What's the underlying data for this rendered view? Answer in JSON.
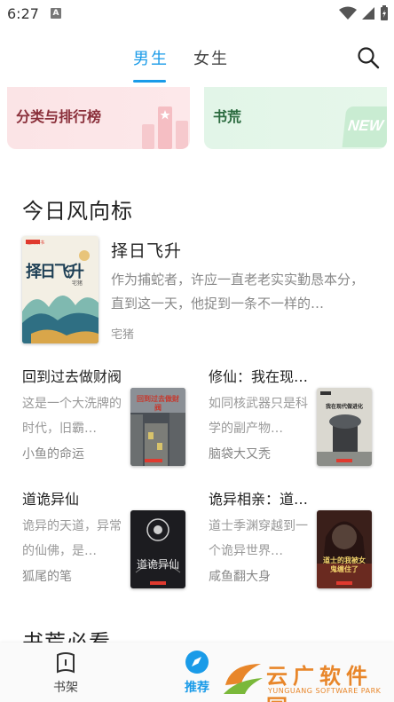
{
  "status_bar": {
    "time": "6:27",
    "notif_letter": "A"
  },
  "tabs": [
    {
      "label": "男生"
    },
    {
      "label": "女生"
    }
  ],
  "categories": {
    "rank_label": "分类与排行榜",
    "new_label": "书荒",
    "new_badge": "NEW"
  },
  "section": {
    "title": "今日风向标",
    "next_title": "书荒必看"
  },
  "featured": {
    "title": "择日飞升",
    "description": "作为捕蛇者，许应一直老老实实勤恳本分，直到这一天，他捉到一条不一样的…",
    "author": "宅猪",
    "cover_text": "择日飞升",
    "cover_author": "宅猪",
    "cover_brand": "起点读书"
  },
  "books": [
    {
      "title": "回到过去做财阀",
      "description": "这是一个大洗牌的时代，旧霸…",
      "author": "小鱼的命运",
      "cover_text": "回到过去做财阀"
    },
    {
      "title": "修仙：我在现…",
      "description": "如同核武器只是科学的副产物…",
      "author": "脑袋大又秃",
      "cover_text": "我在现代做进化"
    },
    {
      "title": "道诡异仙",
      "description": "诡异的天道，异常的仙佛，是…",
      "author": "狐尾的笔",
      "cover_text": "道诡异仙"
    },
    {
      "title": "诡异相亲：道…",
      "description": "道士季渊穿越到一个诡异世界…",
      "author": "咸鱼翻大身",
      "cover_text": "道士的我被女鬼缠住了"
    }
  ],
  "bottom_nav": {
    "shelf_label": "书架",
    "recommend_label": "推荐"
  },
  "watermark": {
    "text": "云广软件园",
    "sub": "YUNGUANG SOFTWARE PARK"
  },
  "colors": {
    "accent": "#1a9be8",
    "rank_bg": "#fbe4e6",
    "new_bg": "#e2f5e8"
  }
}
